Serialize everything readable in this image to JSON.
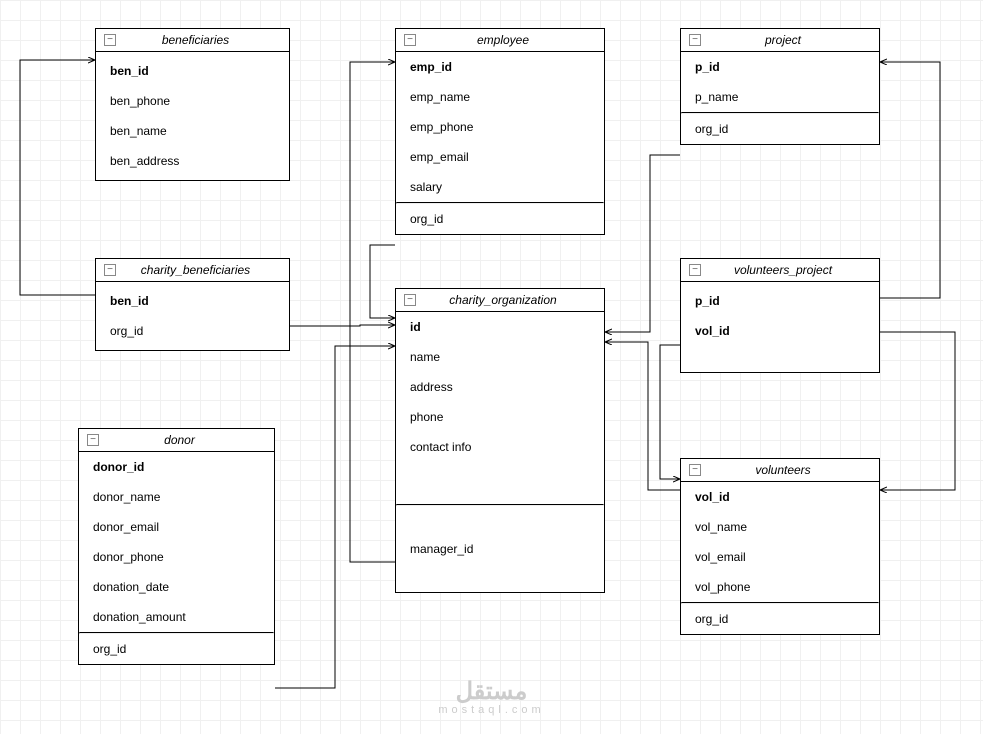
{
  "entities": {
    "beneficiaries": {
      "title": "beneficiaries",
      "fields": [
        "ben_id",
        "ben_phone",
        "ben_name",
        "ben_address"
      ],
      "pk": [
        "ben_id"
      ]
    },
    "charity_beneficiaries": {
      "title": "charity_beneficiaries",
      "fields": [
        "ben_id",
        "org_id"
      ],
      "pk": [
        "ben_id"
      ]
    },
    "donor": {
      "title": "donor",
      "fields": [
        "donor_id",
        "donor_name",
        "donor_email",
        "donor_phone",
        "donation_date",
        "donation_amount"
      ],
      "fk": [
        "org_id"
      ],
      "pk": [
        "donor_id"
      ]
    },
    "employee": {
      "title": "employee",
      "fields": [
        "emp_id",
        "emp_name",
        "emp_phone",
        "emp_email",
        "salary"
      ],
      "fk": [
        "org_id"
      ],
      "pk": [
        "emp_id"
      ]
    },
    "charity_organization": {
      "title": "charity_organization",
      "fields": [
        "id",
        "name",
        "address",
        "phone",
        "contact info"
      ],
      "fk": [
        "manager_id"
      ],
      "pk": [
        "id"
      ]
    },
    "project": {
      "title": "project",
      "fields": [
        "p_id",
        "p_name"
      ],
      "fk": [
        "org_id"
      ],
      "pk": [
        "p_id"
      ]
    },
    "volunteers_project": {
      "title": "volunteers_project",
      "fields": [
        "p_id",
        "vol_id"
      ],
      "pk": [
        "p_id",
        "vol_id"
      ]
    },
    "volunteers": {
      "title": "volunteers",
      "fields": [
        "vol_id",
        "vol_name",
        "vol_email",
        "vol_phone"
      ],
      "fk": [
        "org_id"
      ],
      "pk": [
        "vol_id"
      ]
    }
  },
  "watermark": {
    "main": "مستقل",
    "sub": "mostaql.com"
  },
  "collapse_glyph": "−"
}
